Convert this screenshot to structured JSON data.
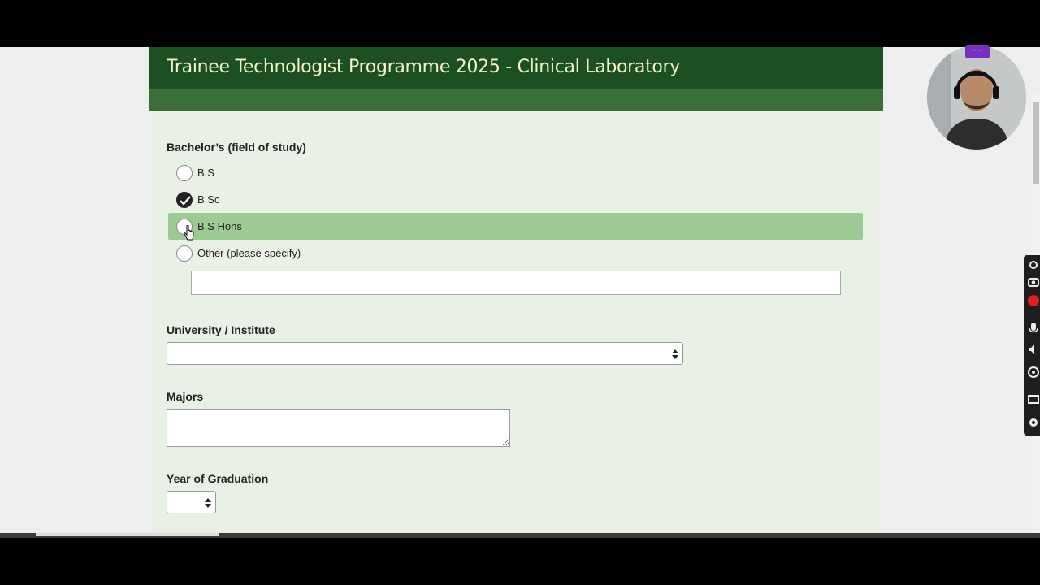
{
  "form": {
    "title": "Trainee Technologist Programme 2025 - Clinical Laboratory",
    "header_color": "#1c4f22",
    "accent_color": "#9ccc94"
  },
  "bachelors": {
    "label": "Bachelor’s (field of study)",
    "options": [
      {
        "label": "B.S",
        "checked": false
      },
      {
        "label": "B.Sc",
        "checked": true
      },
      {
        "label": "B.S Hons",
        "checked": false,
        "hovered": true
      },
      {
        "label": "Other (please specify)",
        "checked": false
      }
    ],
    "other_value": ""
  },
  "university": {
    "label": "University / Institute",
    "selected": ""
  },
  "majors": {
    "label": "Majors",
    "value": ""
  },
  "graduation": {
    "label": "Year of Graduation",
    "selected": ""
  },
  "webcam": {
    "badge": "···"
  }
}
